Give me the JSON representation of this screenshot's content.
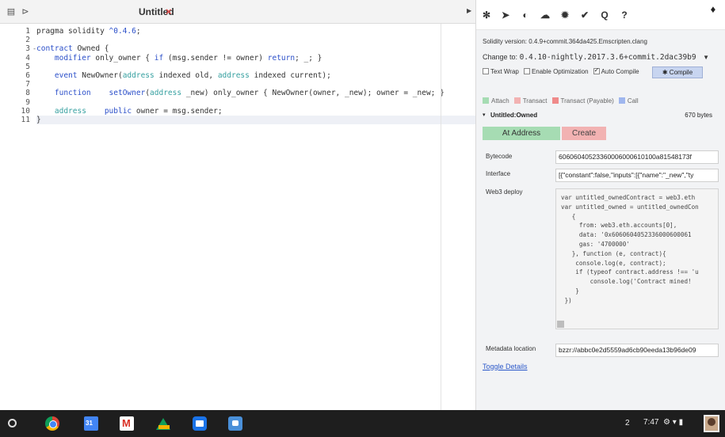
{
  "tab": {
    "title": "Untitled",
    "close_icon": "×"
  },
  "editor": {
    "line_numbers": [
      "1",
      "2",
      "3",
      "4",
      "5",
      "6",
      "7",
      "8",
      "9",
      "10",
      "11"
    ],
    "active_line": 11
  },
  "panel": {
    "solc_version": "Solidity version: 0.4.9+commit.364da425.Emscripten.clang",
    "change_to_label": "Change to:",
    "change_to_value": "0.4.10-nightly.2017.3.6+commit.2dac39b9",
    "options": {
      "text_wrap": "Text Wrap",
      "enable_optimization": "Enable Optimization",
      "auto_compile": "Auto Compile",
      "auto_compile_checked": true
    },
    "compile_label": "Compile",
    "legend": [
      {
        "label": "Attach",
        "color": "#a6dcb3"
      },
      {
        "label": "Transact",
        "color": "#f2b2b2"
      },
      {
        "label": "Transact (Payable)",
        "color": "#ef8a8a"
      },
      {
        "label": "Call",
        "color": "#9fb6ee"
      }
    ],
    "contract_name": "Untitled:Owned",
    "bytes_size": "670 bytes",
    "at_address_label": "At Address",
    "create_label": "Create",
    "bytecode_label": "Bytecode",
    "bytecode_value": "60606040523360006000610100a81548173f",
    "interface_label": "Interface",
    "interface_value": "[{\"constant\":false,\"inputs\":[{\"name\":\"_new\",\"ty",
    "web3_label": "Web3 deploy",
    "web3_lines": [
      "var untitled_ownedContract = web3.eth",
      "var untitled_owned = untitled_ownedCon",
      "   {",
      "     from: web3.eth.accounts[0],",
      "     data: '0x6060604052336000600061",
      "     gas: '4700000'",
      "   }, function (e, contract){",
      "    console.log(e, contract);",
      "    if (typeof contract.address !== 'u",
      "        console.log('Contract mined!",
      "    }",
      " })"
    ],
    "metadata_label": "Metadata location",
    "metadata_value": "bzzr://abbc0e2d5559ad6cb90eeda13b96de09",
    "toggle_details": "Toggle Details"
  },
  "taskbar": {
    "notification_count": "2",
    "time": "7:47"
  },
  "colors": {
    "keyword": "#2b4fc9",
    "type": "#36a0a0",
    "accent_link": "#2b58c9"
  }
}
